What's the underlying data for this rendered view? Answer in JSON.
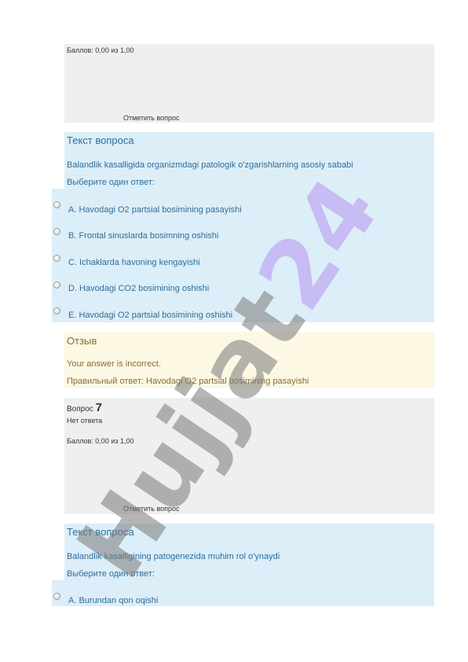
{
  "q6": {
    "grade": "Баллов: 0,00 из 1,00",
    "flag": "Отметить вопрос",
    "text_heading": "Текст вопроса",
    "question": "Balandlik kasalligida organizmdagi patologik o'zgarishlarning asosiy sababi",
    "prompt": "Выберите один ответ:",
    "answers": [
      "A. Havodagi O2 partsial bosimining pasayishi",
      "B. Frontal sinuslarda bosimning oshishi",
      "C. Ichaklarda havoning kengayishi",
      "D. Havodagi CO2 bosimining oshishi",
      "E. Havodagi O2 partsial bosimining oshishi"
    ],
    "feedback_title": "Отзыв",
    "feedback_text": "Your answer is incorrect.",
    "correct_answer": "Правильный ответ: Havodagi O2 partsial bosimining pasayishi"
  },
  "q7": {
    "label": "Вопрос",
    "number": "7",
    "state": "Нет ответа",
    "grade": "Баллов: 0,00 из 1,00",
    "flag": "Отметить вопрос",
    "text_heading": "Текст вопроса",
    "question": "Balandlik kasalligining patogenezida muhim rol o'ynaydi",
    "prompt": "Выберите один ответ:",
    "answers": [
      "A. Burundan qon oqishi"
    ]
  },
  "watermark": {
    "text_main": "Hujjat",
    "text_accent": "24",
    "color_main": "#7a7a7a",
    "color_accent": "#b48cf0"
  }
}
